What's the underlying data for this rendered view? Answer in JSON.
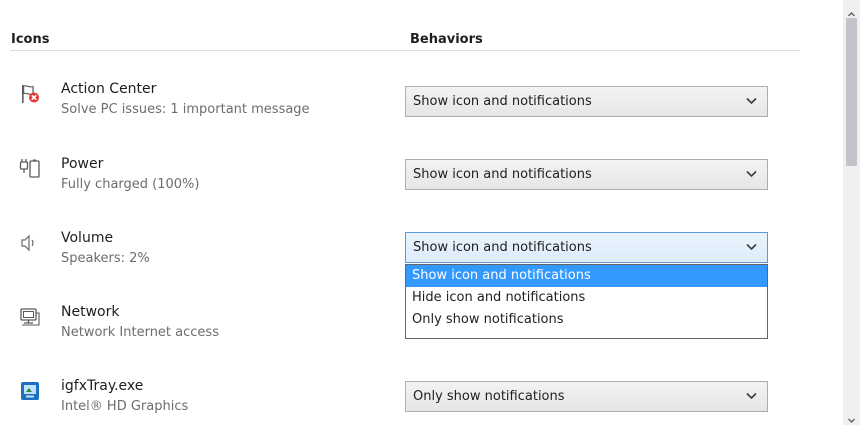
{
  "headers": {
    "icons": "Icons",
    "behaviors": "Behaviors"
  },
  "rows": [
    {
      "name": "Action Center",
      "description": "Solve PC issues: 1 important message",
      "icon": "flag-error-icon",
      "behavior": "Show icon and notifications"
    },
    {
      "name": "Power",
      "description": "Fully charged (100%)",
      "icon": "battery-plug-icon",
      "behavior": "Show icon and notifications"
    },
    {
      "name": "Volume",
      "description": "Speakers: 2%",
      "icon": "speaker-icon",
      "behavior": "Show icon and notifications"
    },
    {
      "name": "Network",
      "description": "Network Internet access",
      "icon": "network-icon",
      "behavior": ""
    },
    {
      "name": "igfxTray.exe",
      "description": "Intel® HD Graphics",
      "icon": "intel-graphics-icon",
      "behavior": "Only show notifications"
    }
  ],
  "dropdown": {
    "options": [
      "Show icon and notifications",
      "Hide icon and notifications",
      "Only show notifications"
    ],
    "selected": "Show icon and notifications"
  },
  "colors": {
    "selection": "#3399ff",
    "active_border": "#5a9bd8",
    "error_red": "#e53935"
  }
}
